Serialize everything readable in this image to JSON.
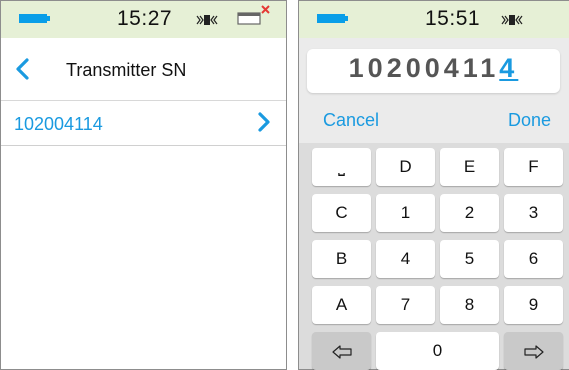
{
  "left": {
    "status": {
      "time": "15:27",
      "battery_icon": "battery-icon",
      "vibrate_icon": "vibrate-icon",
      "transmitter_icon": "transmitter-disconnected-icon"
    },
    "nav": {
      "back_icon": "chevron-left-icon",
      "title": "Transmitter SN"
    },
    "list": [
      {
        "label": "102004114",
        "chevron_icon": "chevron-right-icon"
      }
    ]
  },
  "right": {
    "status": {
      "time": "15:51",
      "battery_icon": "battery-icon",
      "vibrate_icon": "vibrate-icon"
    },
    "input": {
      "value_prefix": "10200411",
      "value_cursor_char": "4"
    },
    "actions": {
      "cancel_label": "Cancel",
      "done_label": "Done"
    },
    "keypad": {
      "keys": [
        "⎵",
        "D",
        "E",
        "F",
        "C",
        "1",
        "2",
        "3",
        "B",
        "4",
        "5",
        "6",
        "A",
        "7",
        "8",
        "9",
        "0"
      ],
      "left_arrow_icon": "arrow-left-icon",
      "right_arrow_icon": "arrow-right-icon"
    }
  },
  "colors": {
    "accent": "#1a9ae0",
    "status_bar": "#e6f0d6",
    "battery": "#0a9ee8",
    "keypad_bg": "#dcdcdc",
    "key_gray": "#c9c9c9",
    "close_red": "#e53935"
  }
}
